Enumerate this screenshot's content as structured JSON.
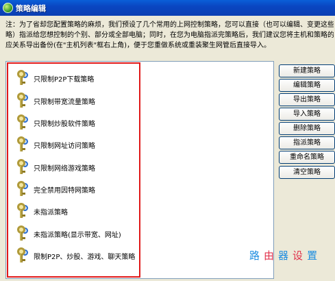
{
  "window": {
    "title": "策略编辑"
  },
  "note": {
    "line1": "注：为了省却您配置策略的麻烦，我们预设了几个常用的上网控制策略，您可以直接（也可以编辑、变更这些策",
    "line2": "略）指派给您想控制的个别、部分或全部电脑；同时，在您为电脑指派完策略后，我们建议您将主机和策略的对",
    "line3": "应关系导出备份(在\"主机列表\"框右上角)，便于您重做系统或重装聚生网管后直接导入。"
  },
  "policies": [
    {
      "label": "只限制P2P下载策略",
      "icon": "keys-icon"
    },
    {
      "label": "只限制带宽流量策略",
      "icon": "keys-icon"
    },
    {
      "label": "只限制炒股软件策略",
      "icon": "keys-icon"
    },
    {
      "label": "只限制网址访问策略",
      "icon": "keys-icon"
    },
    {
      "label": "只限制网络游戏策略",
      "icon": "keys-icon"
    },
    {
      "label": "完全禁用因特网策略",
      "icon": "keys-icon"
    },
    {
      "label": "未指派策略",
      "icon": "keys-icon"
    },
    {
      "label": "未指派策略(显示带宽、网址)",
      "icon": "keys-icon"
    },
    {
      "label": "限制P2P、炒股、游戏、聊天策略",
      "icon": "keys-icon"
    }
  ],
  "buttons": {
    "new": "新建策略",
    "edit": "编辑策略",
    "export": "导出策略",
    "import": "导入策略",
    "delete": "删除策略",
    "assign": "指派策略",
    "rename": "重命名策略",
    "clear": "清空策略"
  },
  "watermark": {
    "chars": [
      "路",
      "由",
      "器",
      "设",
      "置"
    ]
  },
  "colors": {
    "highlight": "#e01818",
    "titlebar": "#0a46c1"
  }
}
